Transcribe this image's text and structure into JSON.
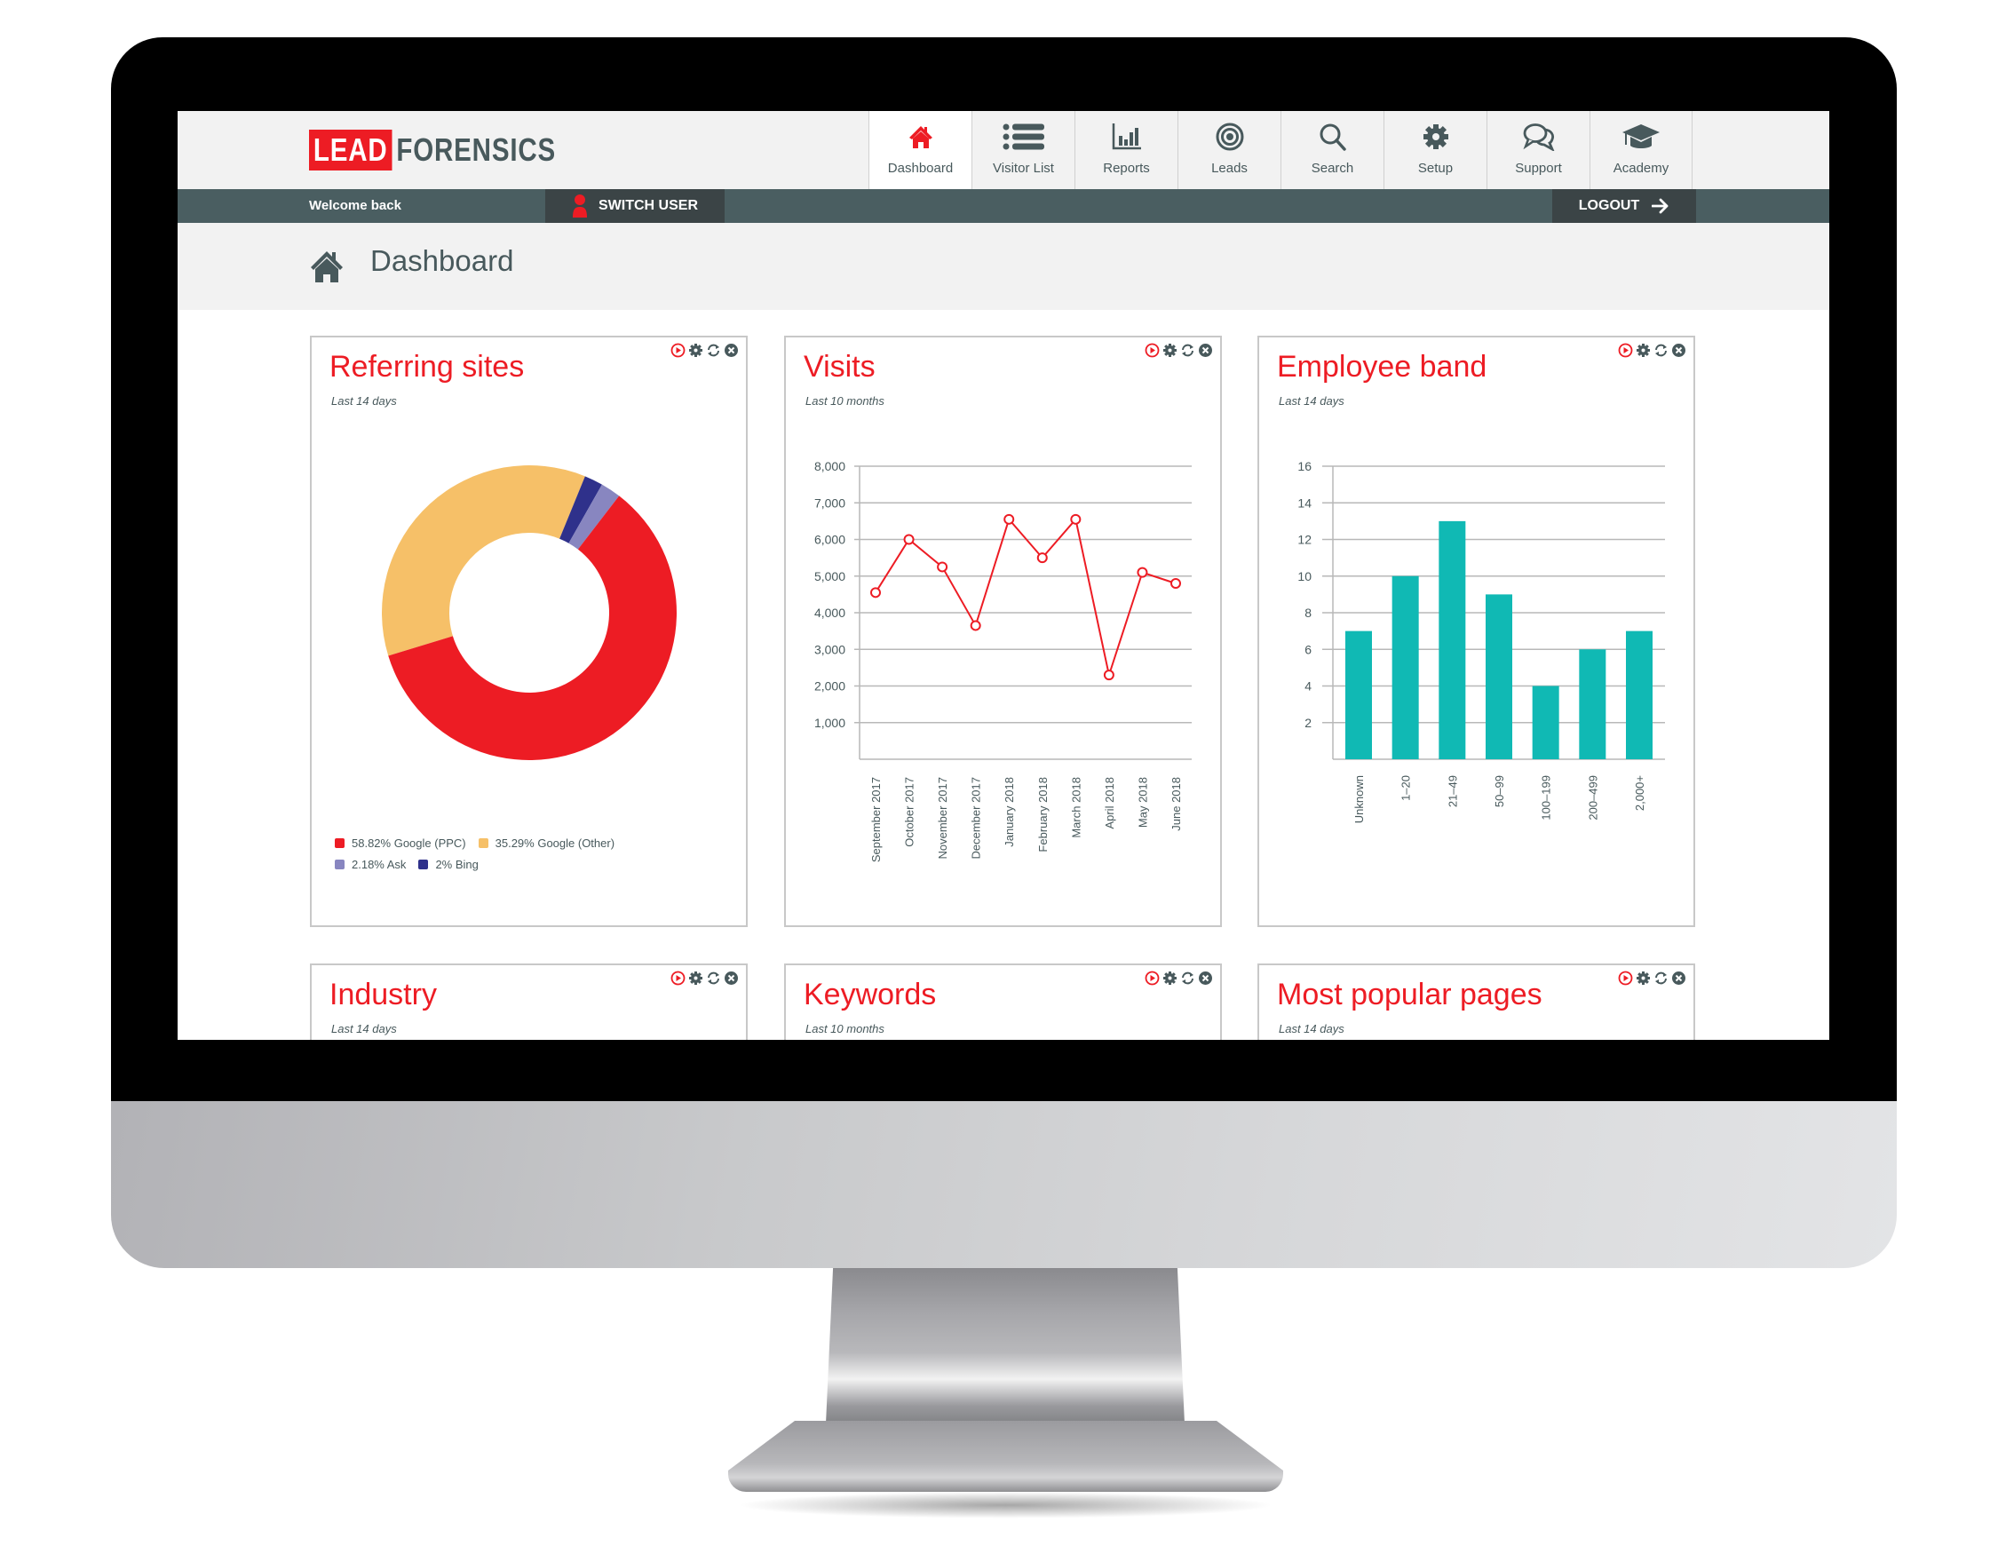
{
  "app": {
    "logo_part1": "LEAD",
    "logo_part2": "FORENSICS",
    "brand_color": "#ed1c24",
    "dark_color": "#48595c"
  },
  "nav": {
    "items": [
      {
        "label": "Dashboard",
        "icon": "home-icon",
        "active": true
      },
      {
        "label": "Visitor List",
        "icon": "list-icon",
        "active": false
      },
      {
        "label": "Reports",
        "icon": "bar-chart-icon",
        "active": false
      },
      {
        "label": "Leads",
        "icon": "target-icon",
        "active": false
      },
      {
        "label": "Search",
        "icon": "search-icon",
        "active": false
      },
      {
        "label": "Setup",
        "icon": "gear-icon",
        "active": false
      },
      {
        "label": "Support",
        "icon": "chat-bubbles-icon",
        "active": false
      },
      {
        "label": "Academy",
        "icon": "graduation-cap-icon",
        "active": false
      }
    ]
  },
  "statusbar": {
    "welcome": "Welcome back",
    "switch_user": "SWITCH USER",
    "logout": "LOGOUT"
  },
  "page": {
    "title": "Dashboard"
  },
  "widgets": [
    {
      "title": "Referring sites",
      "subtitle": "Last 14 days"
    },
    {
      "title": "Visits",
      "subtitle": "Last 10 months"
    },
    {
      "title": "Employee band",
      "subtitle": "Last 14 days"
    },
    {
      "title": "Industry",
      "subtitle": "Last 14 days"
    },
    {
      "title": "Keywords",
      "subtitle": "Last 10 months"
    },
    {
      "title": "Most popular pages",
      "subtitle": "Last 14 days"
    }
  ],
  "widget_tools": [
    "play-icon",
    "gear-icon",
    "refresh-icon",
    "close-icon"
  ],
  "chart_data": [
    {
      "type": "pie",
      "title": "Referring sites",
      "subtitle": "Last 14 days",
      "donut": true,
      "slices": [
        {
          "label": "Google (PPC)",
          "value": 58.82,
          "legend": "58.82% Google (PPC)",
          "color": "#ed1c24"
        },
        {
          "label": "Google (Other)",
          "value": 35.29,
          "legend": "35.29% Google (Other)",
          "color": "#f6c068"
        },
        {
          "label": "Ask",
          "value": 2.18,
          "legend": "2.18% Ask",
          "color": "#8886c0"
        },
        {
          "label": "Bing",
          "value": 2,
          "legend": "2% Bing",
          "color": "#2f318b"
        }
      ],
      "legend_position": "bottom-left"
    },
    {
      "type": "line",
      "title": "Visits",
      "subtitle": "Last 10 months",
      "categories": [
        "September 2017",
        "October 2017",
        "November 2017",
        "December 2017",
        "January 2018",
        "February 2018",
        "March 2018",
        "April 2018",
        "May 2018",
        "June 2018"
      ],
      "series": [
        {
          "name": "Visits",
          "values": [
            4550,
            6000,
            5250,
            3650,
            6550,
            5500,
            6550,
            2300,
            5100,
            4800
          ],
          "color": "#ed1c24"
        }
      ],
      "yticks": [
        "1,000",
        "2,000",
        "3,000",
        "4,000",
        "5,000",
        "6,000",
        "7,000",
        "8,000"
      ],
      "ylim": [
        0,
        8000
      ],
      "grid": true
    },
    {
      "type": "bar",
      "title": "Employee band",
      "subtitle": "Last 14 days",
      "categories": [
        "Unknown",
        "1–20",
        "21–49",
        "50–99",
        "100–199",
        "200–499",
        "2,000+"
      ],
      "values": [
        7,
        10,
        13,
        9,
        4,
        6,
        7
      ],
      "color": "#10b9b4",
      "yticks": [
        "2",
        "4",
        "6",
        "8",
        "10",
        "12",
        "14",
        "16"
      ],
      "ylim": [
        0,
        16
      ],
      "grid": true
    }
  ]
}
